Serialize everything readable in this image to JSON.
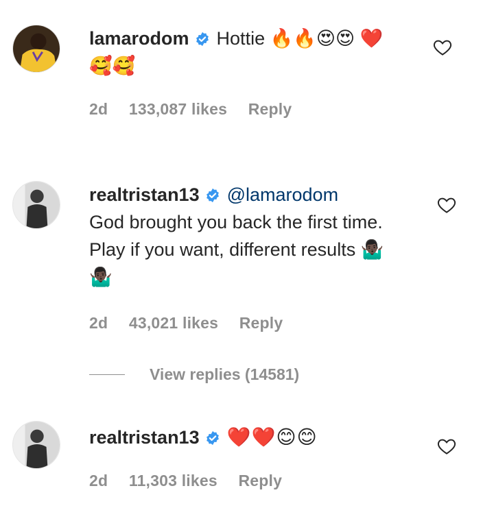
{
  "comments": [
    {
      "username": "lamarodom",
      "verified": true,
      "mention": "",
      "text": "Hottie 🔥🔥😍😍 ❤️🥰🥰",
      "age": "2d",
      "likes": "133,087 likes",
      "reply_label": "Reply",
      "avatar_icon": "avatar-yellow-jersey"
    },
    {
      "username": "realtristan13",
      "verified": true,
      "mention": "@lamarodom",
      "text": "God brought you back the first time. Play if you want, different results 🤷🏿‍♂️🤷🏿‍♂️",
      "age": "2d",
      "likes": "43,021 likes",
      "reply_label": "Reply",
      "avatar_icon": "avatar-gray-portrait"
    },
    {
      "username": "realtristan13",
      "verified": true,
      "mention": "",
      "text": "❤️❤️😊😊",
      "age": "2d",
      "likes": "11,303 likes",
      "reply_label": "Reply",
      "avatar_icon": "avatar-gray-portrait"
    }
  ],
  "view_replies": "View replies (14581)",
  "colors": {
    "verified_blue": "#3897f0",
    "meta_gray": "#8e8e8e",
    "mention_blue": "#00376b"
  }
}
